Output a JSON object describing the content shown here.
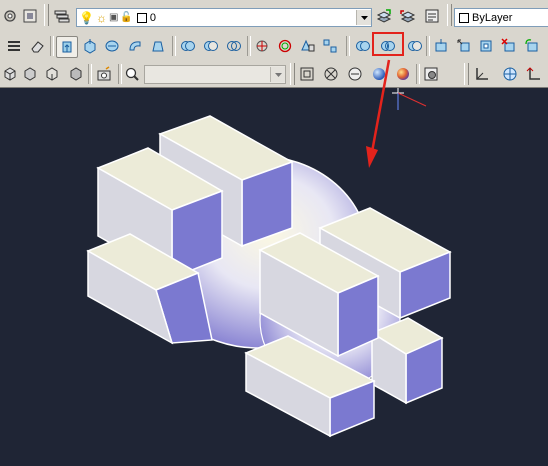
{
  "toolbar_row1": {
    "layer_combo": {
      "value": "0",
      "icons": [
        "lightbulb-icon",
        "sun-icon",
        "layer-freeze-icon",
        "lock-icon",
        "color-swatch-icon"
      ]
    },
    "color_combo": {
      "value": "ByLayer"
    }
  },
  "toolbar_row2": {
    "highlighted_tool": "intersect-tool"
  },
  "toolbar_row3": {
    "style_combo": {
      "value": ""
    }
  },
  "colors": {
    "toolbar_bg": "#d9d6ce",
    "canvas_bg": "#1f2535",
    "highlight": "#e3231c",
    "solid_top": "#ecebd8",
    "solid_side": "#7b79d0"
  }
}
